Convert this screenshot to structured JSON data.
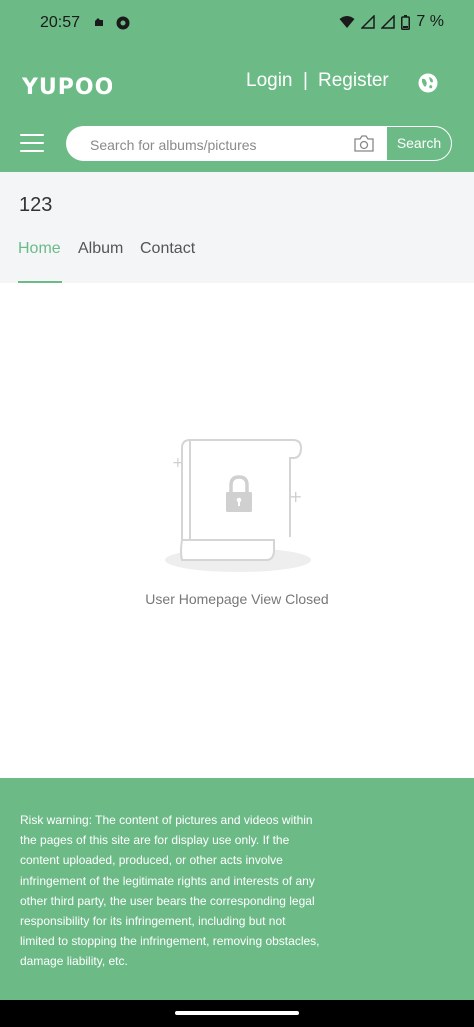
{
  "status": {
    "time": "20:57",
    "battery": "7 %"
  },
  "header": {
    "logo": "YUPOO",
    "login": "Login",
    "separator": "|",
    "register": "Register"
  },
  "search": {
    "placeholder": "Search for albums/pictures",
    "button": "Search"
  },
  "profile": {
    "username": "123",
    "tabs": [
      {
        "label": "Home",
        "active": true
      },
      {
        "label": "Album",
        "active": false
      },
      {
        "label": "Contact",
        "active": false
      }
    ]
  },
  "empty_state": {
    "message": "User Homepage View Closed"
  },
  "footer": {
    "risk_warning": "Risk warning: The content of pictures and videos within the pages of this site are for display use only. If the content uploaded, produced, or other acts involve infringement of the legitimate rights and interests of any other third party, the user bears the corresponding legal responsibility for its infringement, including but not limited to stopping the infringement, removing obstacles, damage liability, etc."
  },
  "colors": {
    "brand": "#6cbb87",
    "band": "#f4f5f7"
  }
}
